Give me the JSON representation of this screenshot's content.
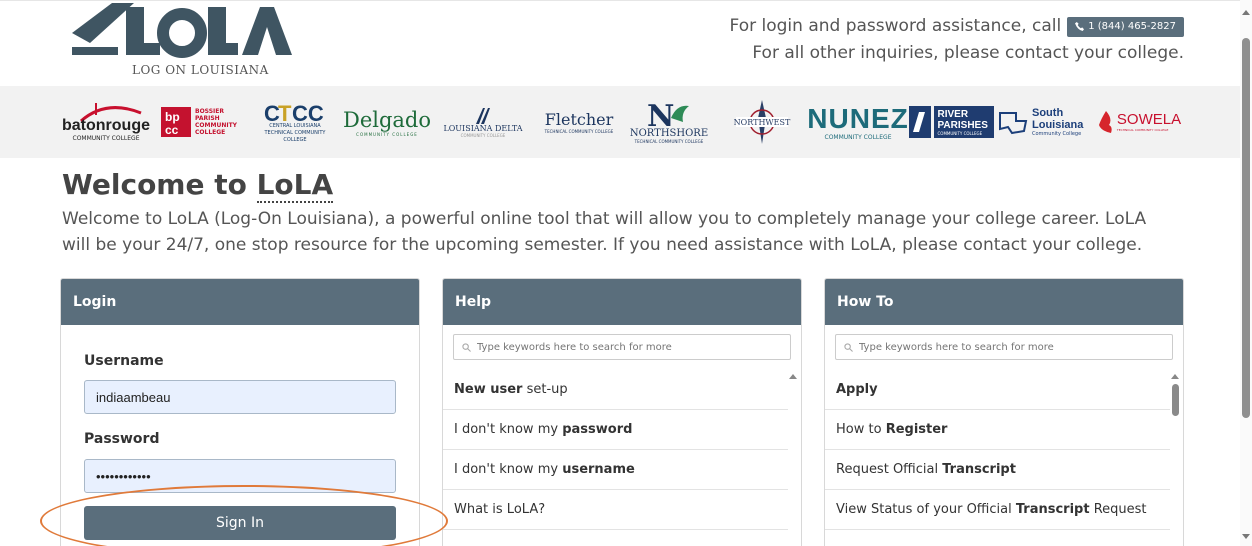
{
  "header": {
    "logo_text": "LoLA",
    "logo_subtitle": "LOG ON LOUISIANA",
    "contact_line1": "For login and password assistance, call",
    "phone": "1 (844) 465-2827",
    "contact_line2": "For all other inquiries, please contact your college."
  },
  "colleges": [
    {
      "name": "batonrouge",
      "sub": "COMMUNITY COLLEGE"
    },
    {
      "name": "BOSSIER PARISH COMMUNITY COLLEGE",
      "sub": ""
    },
    {
      "name": "CENTRAL LOUISIANA TECHNICAL COMMUNITY COLLEGE",
      "sub": ""
    },
    {
      "name": "Delgado",
      "sub": "COMMUNITY COLLEGE"
    },
    {
      "name": "LOUISIANA DELTA",
      "sub": "COMMUNITY COLLEGE"
    },
    {
      "name": "Fletcher",
      "sub": "TECHNICAL COMMUNITY COLLEGE"
    },
    {
      "name": "NORTHSHORE",
      "sub": "TECHNICAL COMMUNITY COLLEGE"
    },
    {
      "name": "NORTHWEST",
      "sub": ""
    },
    {
      "name": "NUNEZ",
      "sub": "COMMUNITY COLLEGE"
    },
    {
      "name": "RIVER PARISHES",
      "sub": "COMMUNITY COLLEGE"
    },
    {
      "name": "South Louisiana",
      "sub": "Community College"
    },
    {
      "name": "SOWELA",
      "sub": "TECHNICAL COMMUNITY COLLEGE"
    }
  ],
  "welcome": {
    "title_prefix": "Welcome to ",
    "title_lola": "LoLA",
    "text": "Welcome to LoLA (Log-On Louisiana), a powerful online tool that will allow you to completely manage your college career. LoLA will be your 24/7, one stop resource for the upcoming semester. If you need assistance with LoLA, please contact your college."
  },
  "login": {
    "title": "Login",
    "username_label": "Username",
    "username_value": "indiaambeau",
    "password_label": "Password",
    "password_value": "••••••••••••",
    "signin_label": "Sign In"
  },
  "help": {
    "title": "Help",
    "search_placeholder": "Type keywords here to search for more",
    "items": [
      {
        "pre": "",
        "bold": "New user",
        "post": " set-up"
      },
      {
        "pre": "I don't know my ",
        "bold": "password",
        "post": ""
      },
      {
        "pre": "I don't know my ",
        "bold": "username",
        "post": ""
      },
      {
        "pre": "What is LoLA?",
        "bold": "",
        "post": ""
      }
    ]
  },
  "howto": {
    "title": "How To",
    "search_placeholder": "Type keywords here to search for more",
    "items": [
      {
        "pre": "",
        "bold": "Apply",
        "post": ""
      },
      {
        "pre": "How to ",
        "bold": "Register",
        "post": ""
      },
      {
        "pre": "Request Official ",
        "bold": "Transcript",
        "post": ""
      },
      {
        "pre": "View Status of your Official ",
        "bold": "Transcript",
        "post": " Request"
      }
    ]
  },
  "colors": {
    "panel_header": "#5a6e7c",
    "annotation": "#e07a3a"
  }
}
